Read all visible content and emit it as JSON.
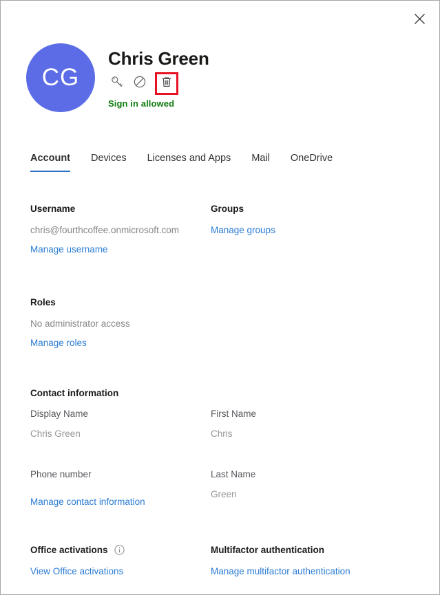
{
  "window": {
    "close_label": "×"
  },
  "header": {
    "avatar_initials": "CG",
    "display_name": "Chris Green",
    "signin_status": "Sign in allowed",
    "actions": [
      {
        "name": "reset-password-icon",
        "label": "Reset password"
      },
      {
        "name": "block-signin-icon",
        "label": "Block sign-in"
      },
      {
        "name": "delete-user-icon",
        "label": "Delete user"
      }
    ],
    "highlight_color": "#e81123",
    "avatar_color": "#5b6ce6",
    "status_color": "#107c10"
  },
  "tabs": [
    {
      "label": "Account",
      "active": true
    },
    {
      "label": "Devices",
      "active": false
    },
    {
      "label": "Licenses and Apps",
      "active": false
    },
    {
      "label": "Mail",
      "active": false
    },
    {
      "label": "OneDrive",
      "active": false
    }
  ],
  "sections": {
    "username": {
      "title": "Username",
      "value": "chris@fourthcoffee.onmicrosoft.com",
      "link": "Manage username"
    },
    "groups": {
      "title": "Groups",
      "link": "Manage groups"
    },
    "roles": {
      "title": "Roles",
      "value": "No administrator access",
      "link": "Manage roles"
    },
    "contact": {
      "title": "Contact information",
      "display_name_label": "Display Name",
      "display_name_value": "Chris Green",
      "first_name_label": "First Name",
      "first_name_value": "Chris",
      "phone_label": "Phone number",
      "last_name_label": "Last Name",
      "last_name_value": "Green",
      "link": "Manage contact information"
    },
    "office_activations": {
      "title": "Office activations",
      "info_icon": "info-icon",
      "link": "View Office activations"
    },
    "mfa": {
      "title": "Multifactor authentication",
      "link": "Manage multifactor authentication"
    }
  },
  "colors": {
    "accent": "#2b7cd3",
    "tab_underline": "#2b72c7",
    "link": "#2b7cd3"
  }
}
